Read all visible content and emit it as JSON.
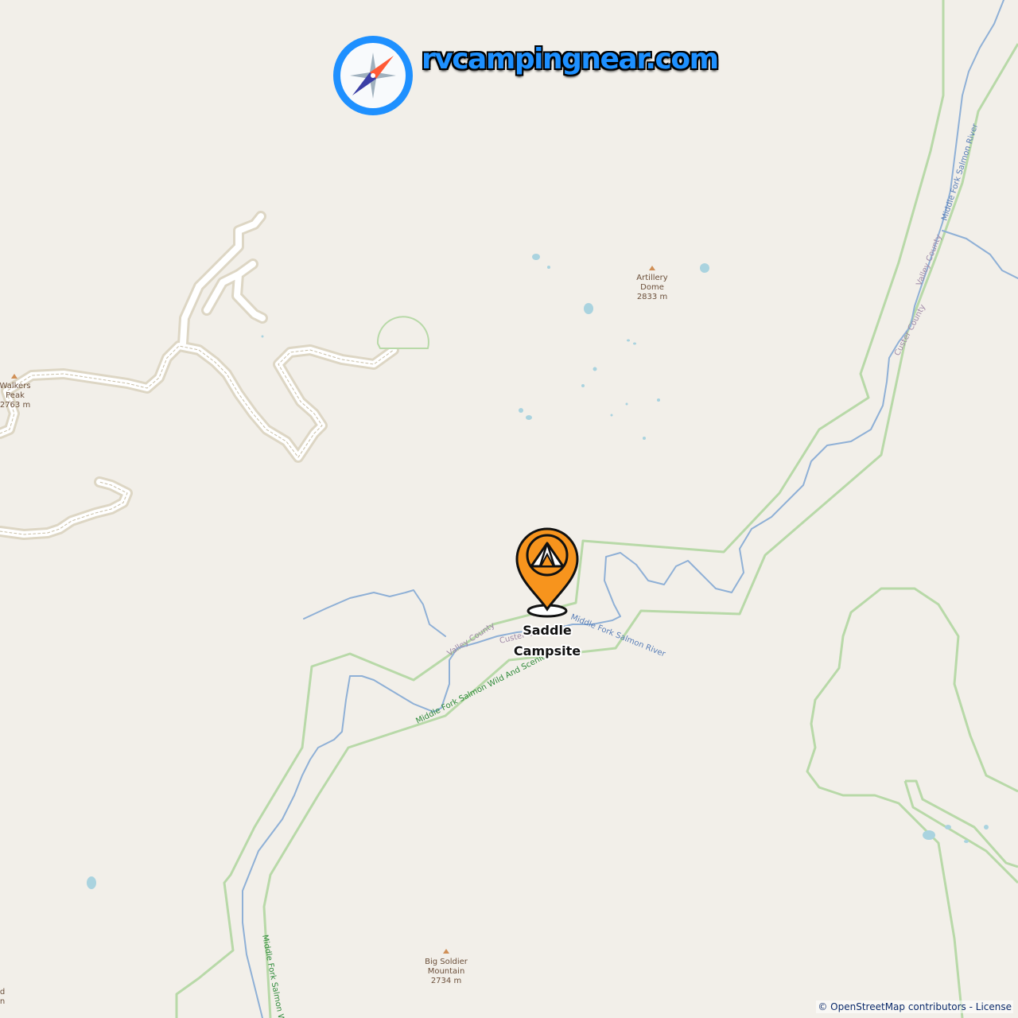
{
  "map": {
    "peaks": [
      {
        "name_line1": "Artillery",
        "name_line2": "Dome",
        "elevation": "2833 m"
      },
      {
        "name_line1": "Walkers",
        "name_line2": "Peak",
        "elevation": "2763 m"
      },
      {
        "name_line1": "Big Soldier",
        "name_line2": "Mountain",
        "elevation": "2734 m"
      }
    ],
    "labels": {
      "river_north": "Middle Fork Salmon River",
      "river_center": "Middle Fork Salmon River",
      "river_south": "Middle Fork Salmon W",
      "county_valley_north": "Valley County",
      "county_custer_north": "Custer County",
      "county_valley_center": "Valley County",
      "county_custer_center": "Custer C",
      "park_name": "Middle Fork Salmon Wild And Scenic"
    },
    "edge_fragment_top": "d",
    "edge_fragment_bottom": "n"
  },
  "marker": {
    "name_line1": "Saddle",
    "name_line2": "Campsite",
    "icon": "tent-icon",
    "color": "#f7941d"
  },
  "logo": {
    "text": "rvcampingnear.com",
    "icon": "compass-icon",
    "ring_color": "#1e90ff"
  },
  "attribution": {
    "text": "© OpenStreetMap contributors - License"
  },
  "colors": {
    "land": "#f2efe9",
    "water": "#aad3df",
    "river": "#8fb0d6",
    "boundary_green": "#b8d9a8",
    "road_casing": "#d8d3c4",
    "road_fill": "#ffffff"
  }
}
